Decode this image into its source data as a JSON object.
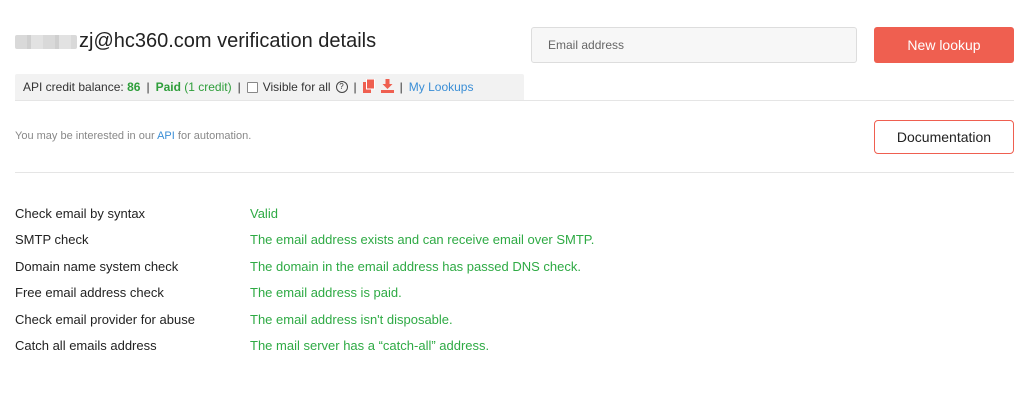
{
  "header": {
    "title": "zj@hc360.com verification details",
    "email_placeholder": "Email address",
    "new_lookup_label": "New lookup"
  },
  "credit_bar": {
    "balance_label": "API credit balance:",
    "balance_value": "86",
    "paid_label": "Paid",
    "paid_note": "(1 credit)",
    "visible_label": "Visible for all",
    "help_glyph": "?",
    "my_lookups_label": "My Lookups",
    "separator": "|",
    "icons": [
      "copy-icon",
      "download-icon"
    ]
  },
  "api_note": {
    "prefix": "You may be interested in our",
    "link": "API",
    "suffix": "for automation."
  },
  "documentation_label": "Documentation",
  "colors": {
    "accent": "#ef5f50",
    "success": "#2eaa44",
    "link": "#3a8ed6"
  },
  "results": [
    {
      "label": "Check email by syntax",
      "value": "Valid"
    },
    {
      "label": "SMTP check",
      "value": "The email address exists and can receive email over SMTP."
    },
    {
      "label": "Domain name system check",
      "value": "The domain in the email address has passed DNS check."
    },
    {
      "label": "Free email address check",
      "value": "The email address is paid."
    },
    {
      "label": "Check email provider for abuse",
      "value": "The email address isn't disposable."
    },
    {
      "label": "Catch all emails address",
      "value": "The mail server has a “catch-all” address."
    }
  ]
}
